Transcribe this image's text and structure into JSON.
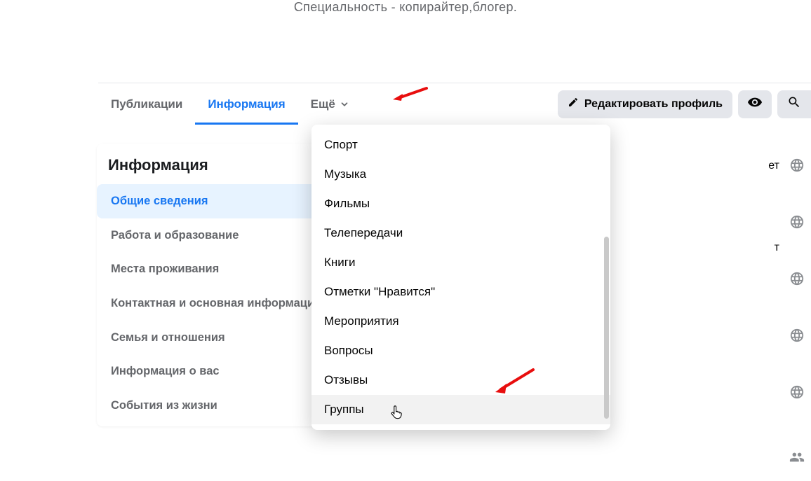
{
  "bio": "Специальность - копирайтер,блогер.",
  "tabs": {
    "posts": "Публикации",
    "info": "Информация",
    "more": "Ещё"
  },
  "actions": {
    "edit_profile": "Редактировать профиль"
  },
  "sidebar": {
    "title": "Информация",
    "items": [
      "Общие сведения",
      "Работа и образование",
      "Места проживания",
      "Контактная и основная информация",
      "Семья и отношения",
      "Информация о вас",
      "События из жизни"
    ],
    "selected_index": 0
  },
  "dropdown": {
    "items": [
      "Спорт",
      "Музыка",
      "Фильмы",
      "Телепередачи",
      "Книги",
      "Отметки \"Нравится\"",
      "Мероприятия",
      "Вопросы",
      "Отзывы",
      "Группы"
    ],
    "hover_index": 9
  },
  "peek": {
    "t1": "ет",
    "t2": "т"
  }
}
